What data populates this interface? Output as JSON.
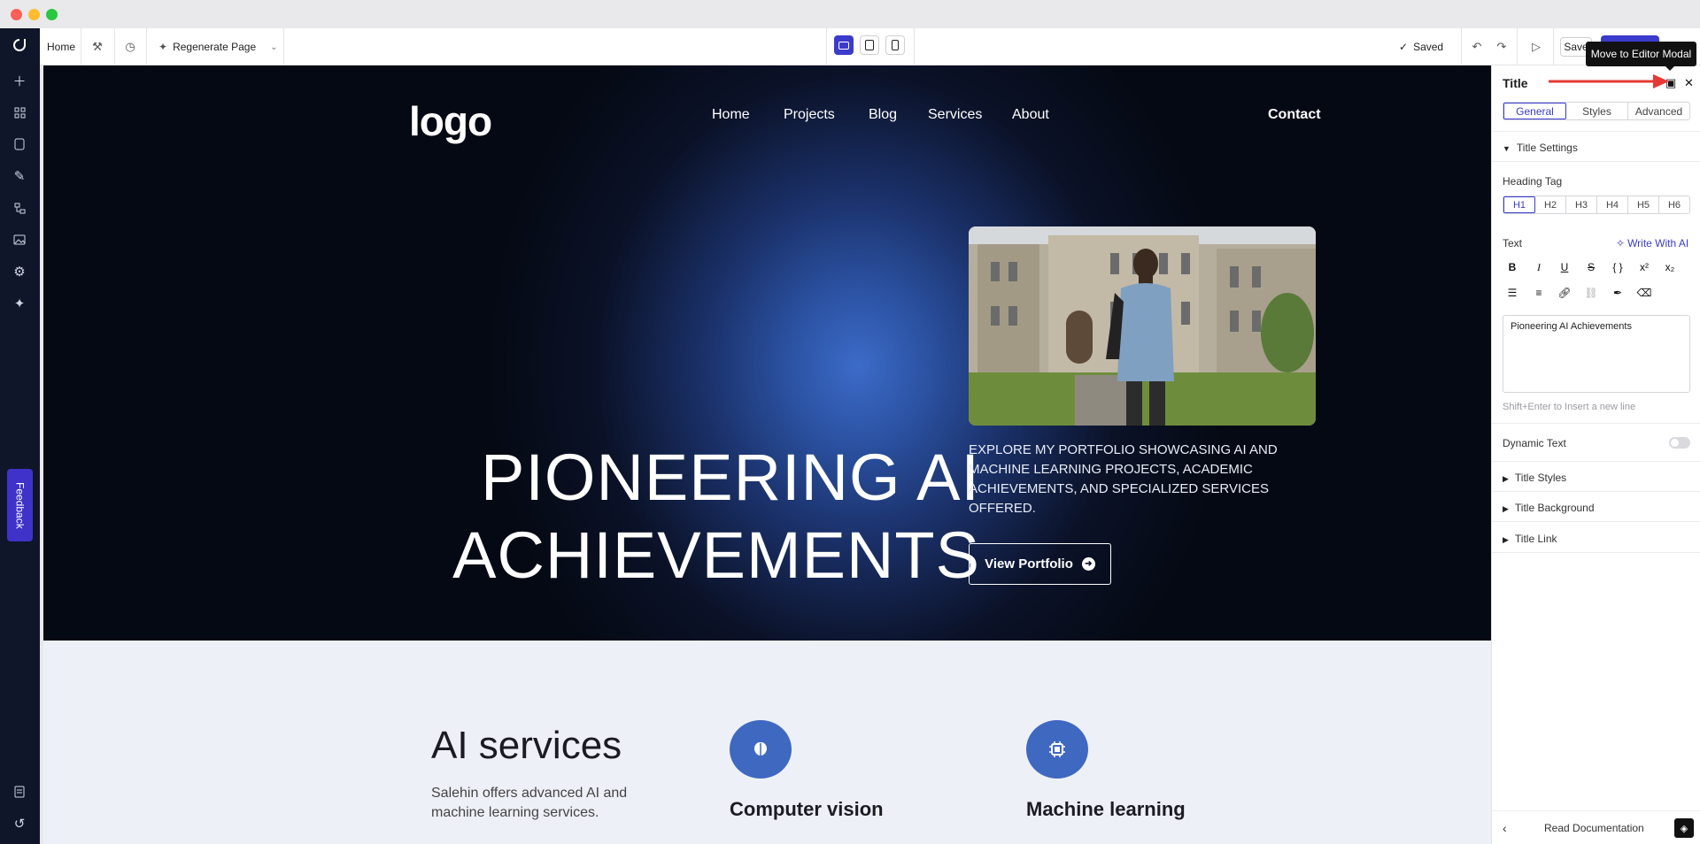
{
  "toolbar": {
    "page_name": "Home",
    "regenerate_label": "Regenerate Page",
    "saved_label": "Saved",
    "save_label": "Save",
    "publish_label": "Publish",
    "tooltip": "Move to Editor Modal"
  },
  "sidebar": {
    "feedback_label": "Feedback",
    "icons": [
      "logo-icon",
      "plus-icon",
      "grid-icon",
      "page-icon",
      "tools-icon",
      "sitemap-icon",
      "image-icon",
      "settings-icon",
      "ai-sparkle-icon",
      "docs-icon",
      "history-icon"
    ]
  },
  "site": {
    "logo": "logo",
    "nav": [
      "Home",
      "Projects",
      "Blog",
      "Services",
      "About"
    ],
    "contact": "Contact",
    "hero_title_line1": "PIONEERING AI",
    "hero_title_line2": "ACHIEVEMENTS",
    "hero_description": "EXPLORE MY PORTFOLIO SHOWCASING AI AND MACHINE LEARNING PROJECTS, ACADEMIC ACHIEVEMENTS, AND SPECIALIZED SERVICES OFFERED.",
    "hero_button": "View Portfolio",
    "services_title": "AI services",
    "services_description": "Salehin offers advanced AI and machine learning services.",
    "service_1": "Computer vision",
    "service_2": "Machine learning"
  },
  "panel": {
    "title": "Title",
    "tabs": [
      "General",
      "Styles",
      "Advanced"
    ],
    "section_title_settings": "Title Settings",
    "heading_tag_label": "Heading Tag",
    "heading_tags": [
      "H1",
      "H2",
      "H3",
      "H4",
      "H5",
      "H6"
    ],
    "selected_heading_tag": "H1",
    "text_label": "Text",
    "write_ai": "Write With AI",
    "text_value": "Pioneering AI Achievements",
    "hint": "Shift+Enter to Insert a new line",
    "dynamic_text_label": "Dynamic Text",
    "dynamic_text_enabled": false,
    "sections": [
      "Title Styles",
      "Title Background",
      "Title Link"
    ],
    "read_docs": "Read Documentation"
  },
  "colors": {
    "accent": "#3b3bcc",
    "rail_bg": "#0f1629",
    "hero_glow": "#3c6bc8",
    "service_icon_bg": "#3f68c0",
    "annotation_arrow": "#e53935"
  }
}
